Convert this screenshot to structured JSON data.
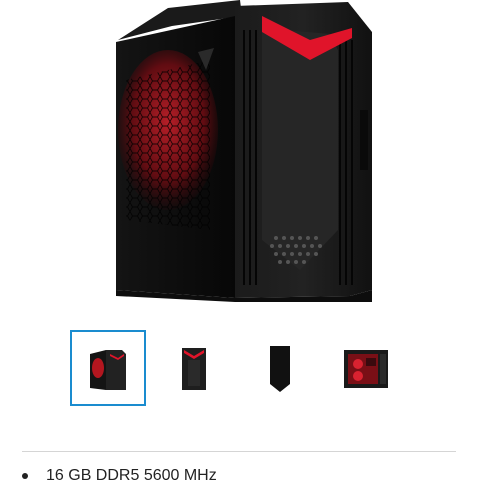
{
  "product": {
    "image_alt": "Gaming desktop tower"
  },
  "gallery": {
    "selected_index": 0,
    "thumbnails": [
      {
        "label": "Front angle view"
      },
      {
        "label": "Front view"
      },
      {
        "label": "Side view"
      },
      {
        "label": "Interior view"
      }
    ]
  },
  "specs": [
    {
      "text": "16 GB DDR5 5600 MHz"
    }
  ],
  "colors": {
    "accent_red": "#e0142a",
    "selection_border": "#1a8ccf"
  }
}
